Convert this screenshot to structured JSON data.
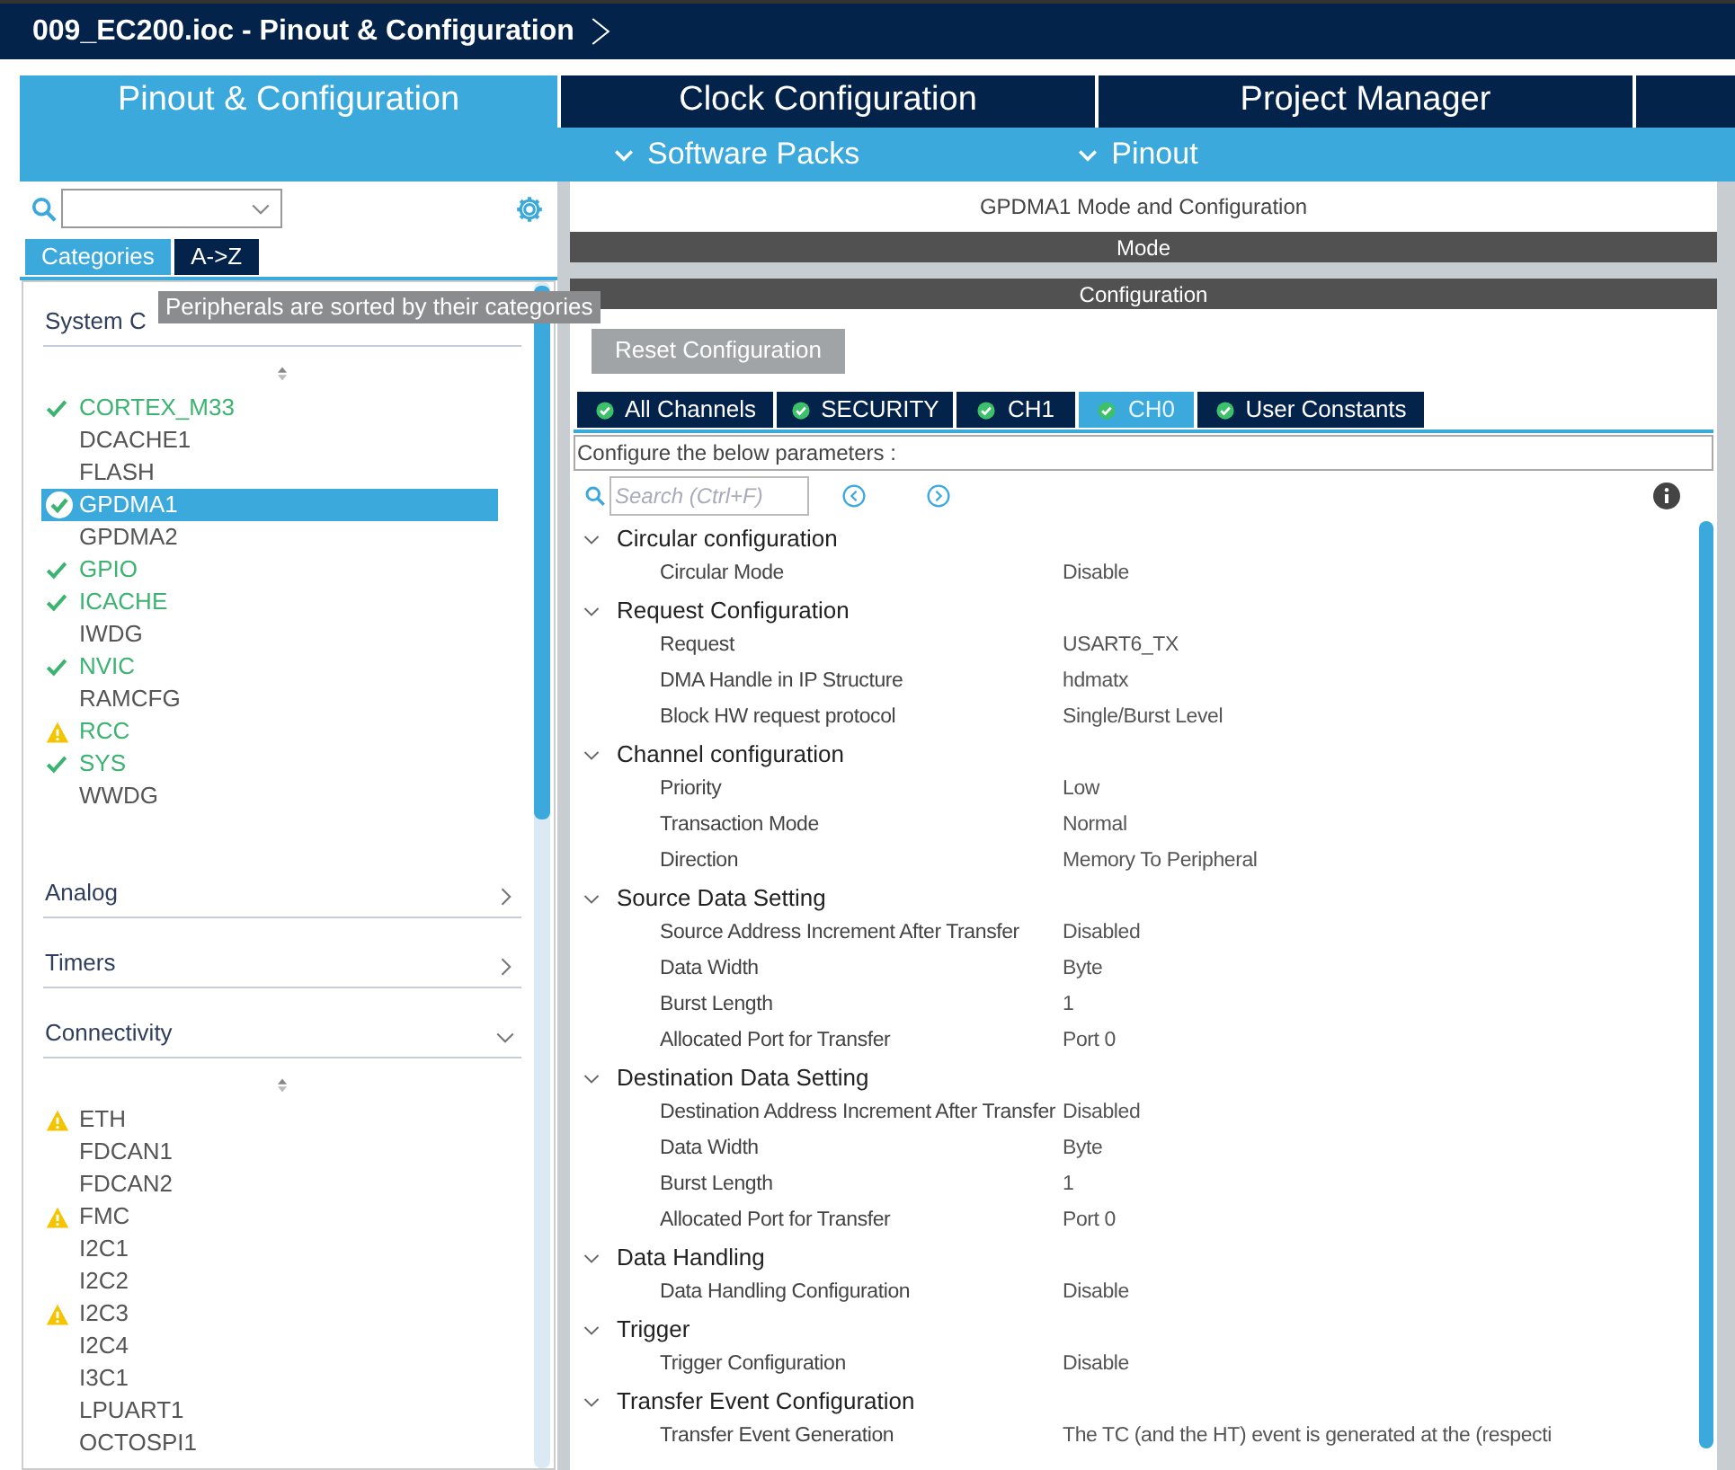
{
  "window": {
    "title": "009_EC200.ioc - Pinout & Configuration"
  },
  "tabs": [
    {
      "label": "Pinout & Configuration",
      "selected": true
    },
    {
      "label": "Clock Configuration",
      "selected": false
    },
    {
      "label": "Project Manager",
      "selected": false
    }
  ],
  "subbar": [
    "Software Packs",
    "Pinout"
  ],
  "sidebar": {
    "view_tabs": [
      {
        "label": "Categories",
        "selected": true
      },
      {
        "label": "A->Z",
        "selected": false
      }
    ],
    "tooltip": "Peripherals are sorted by their categories",
    "categories": [
      {
        "label": "System C",
        "expanded": true,
        "items": [
          {
            "label": "CORTEX_M33",
            "kind": "ok",
            "configured": true,
            "selected": false
          },
          {
            "label": "DCACHE1",
            "kind": "plain",
            "configured": false,
            "selected": false
          },
          {
            "label": "FLASH",
            "kind": "plain",
            "configured": false,
            "selected": false
          },
          {
            "label": "GPDMA1",
            "kind": "ok",
            "configured": true,
            "selected": true
          },
          {
            "label": "GPDMA2",
            "kind": "plain",
            "configured": false,
            "selected": false
          },
          {
            "label": "GPIO",
            "kind": "ok",
            "configured": true,
            "selected": false
          },
          {
            "label": "ICACHE",
            "kind": "ok",
            "configured": true,
            "selected": false
          },
          {
            "label": "IWDG",
            "kind": "plain",
            "configured": false,
            "selected": false
          },
          {
            "label": "NVIC",
            "kind": "ok",
            "configured": true,
            "selected": false
          },
          {
            "label": "RAMCFG",
            "kind": "plain",
            "configured": false,
            "selected": false
          },
          {
            "label": "RCC",
            "kind": "warn",
            "configured": true,
            "selected": false
          },
          {
            "label": "SYS",
            "kind": "ok",
            "configured": true,
            "selected": false
          },
          {
            "label": "WWDG",
            "kind": "plain",
            "configured": false,
            "selected": false
          }
        ]
      },
      {
        "label": "Analog",
        "expanded": false
      },
      {
        "label": "Timers",
        "expanded": false
      },
      {
        "label": "Connectivity",
        "expanded": true,
        "items": [
          {
            "label": "ETH",
            "kind": "warn",
            "configured": false,
            "selected": false
          },
          {
            "label": "FDCAN1",
            "kind": "plain",
            "configured": false,
            "selected": false
          },
          {
            "label": "FDCAN2",
            "kind": "plain",
            "configured": false,
            "selected": false
          },
          {
            "label": "FMC",
            "kind": "warn",
            "configured": false,
            "selected": false
          },
          {
            "label": "I2C1",
            "kind": "plain",
            "configured": false,
            "selected": false
          },
          {
            "label": "I2C2",
            "kind": "plain",
            "configured": false,
            "selected": false
          },
          {
            "label": "I2C3",
            "kind": "warn",
            "configured": false,
            "selected": false
          },
          {
            "label": "I2C4",
            "kind": "plain",
            "configured": false,
            "selected": false
          },
          {
            "label": "I3C1",
            "kind": "plain",
            "configured": false,
            "selected": false
          },
          {
            "label": "LPUART1",
            "kind": "plain",
            "configured": false,
            "selected": false
          },
          {
            "label": "OCTOSPI1",
            "kind": "plain",
            "configured": false,
            "selected": false
          }
        ]
      }
    ]
  },
  "panel": {
    "title": "GPDMA1 Mode and Configuration",
    "mode_bar": "Mode",
    "config_bar": "Configuration",
    "reset_button": {
      "label": "Reset Configuration",
      "disabled": true
    },
    "channel_tabs": [
      {
        "label": "All Channels",
        "selected": false
      },
      {
        "label": "SECURITY",
        "selected": false
      },
      {
        "label": "CH1",
        "selected": false
      },
      {
        "label": "CH0",
        "selected": true
      },
      {
        "label": "User Constants",
        "selected": false
      }
    ],
    "hint": "Configure the below parameters :",
    "search": {
      "placeholder": "Search (Ctrl+F)"
    },
    "groups": [
      {
        "label": "Circular configuration",
        "expanded": true,
        "params": [
          {
            "name": "Circular Mode",
            "value": "Disable"
          }
        ]
      },
      {
        "label": "Request Configuration",
        "expanded": true,
        "params": [
          {
            "name": "Request",
            "value": "USART6_TX"
          },
          {
            "name": "DMA Handle in IP Structure",
            "value": "hdmatx"
          },
          {
            "name": "Block HW request protocol",
            "value": "Single/Burst Level"
          }
        ]
      },
      {
        "label": "Channel configuration",
        "expanded": true,
        "params": [
          {
            "name": "Priority",
            "value": "Low"
          },
          {
            "name": "Transaction Mode",
            "value": "Normal"
          },
          {
            "name": "Direction",
            "value": "Memory To Peripheral"
          }
        ]
      },
      {
        "label": "Source Data Setting",
        "expanded": true,
        "params": [
          {
            "name": "Source Address Increment After Transfer",
            "value": "Disabled"
          },
          {
            "name": "Data Width",
            "value": "Byte"
          },
          {
            "name": "Burst Length",
            "value": "1"
          },
          {
            "name": "Allocated Port for Transfer",
            "value": "Port 0"
          }
        ]
      },
      {
        "label": "Destination Data Setting",
        "expanded": true,
        "params": [
          {
            "name": "Destination Address Increment After Transfer",
            "value": "Disabled"
          },
          {
            "name": "Data Width",
            "value": "Byte"
          },
          {
            "name": "Burst Length",
            "value": "1"
          },
          {
            "name": "Allocated Port for Transfer",
            "value": "Port 0"
          }
        ]
      },
      {
        "label": "Data Handling",
        "expanded": true,
        "params": [
          {
            "name": "Data Handling Configuration",
            "value": "Disable"
          }
        ]
      },
      {
        "label": "Trigger",
        "expanded": true,
        "params": [
          {
            "name": "Trigger Configuration",
            "value": "Disable"
          }
        ]
      },
      {
        "label": "Transfer Event Configuration",
        "expanded": true,
        "params": [
          {
            "name": "Transfer Event Generation",
            "value": "The TC (and the HT) event is generated at the (respecti"
          }
        ]
      }
    ]
  }
}
